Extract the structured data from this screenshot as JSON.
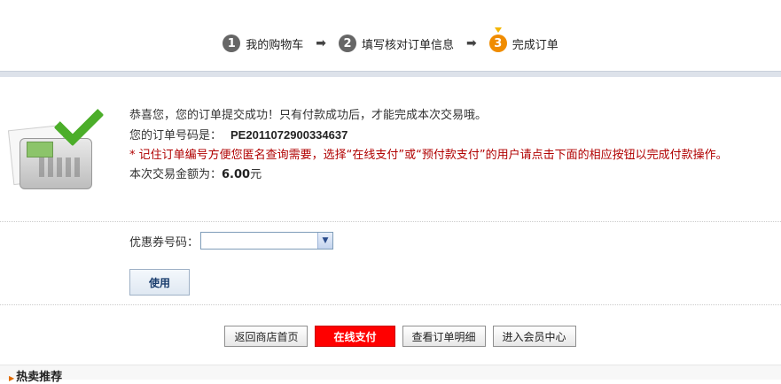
{
  "steps": [
    {
      "num": "1",
      "label": "我的购物车"
    },
    {
      "num": "2",
      "label": "填写核对订单信息"
    },
    {
      "num": "3",
      "label": "完成订单"
    }
  ],
  "message": {
    "success": "恭喜您，您的订单提交成功！只有付款成功后，才能完成本次交易哦。",
    "order_label": "您的订单号码是：",
    "order_no": "PE2011072900334637",
    "notice": "* 记住订单编号方便您匿名查询需要，选择“在线支付”或“预付款支付”的用户请点击下面的相应按钮以完成付款操作。",
    "amount_label": "本次交易金额为：",
    "amount_value": "6.00",
    "amount_unit": "元"
  },
  "coupon": {
    "label": "优惠券号码：",
    "value": ""
  },
  "use_button": "使用",
  "actions": {
    "home": "返回商店首页",
    "pay": "在线支付",
    "detail": "查看订单明细",
    "member": "进入会员中心"
  },
  "hot_title": "热卖推荐",
  "colors": {
    "accent": "#ff0000",
    "notice": "#b00000",
    "step_active": "#f08c00"
  }
}
